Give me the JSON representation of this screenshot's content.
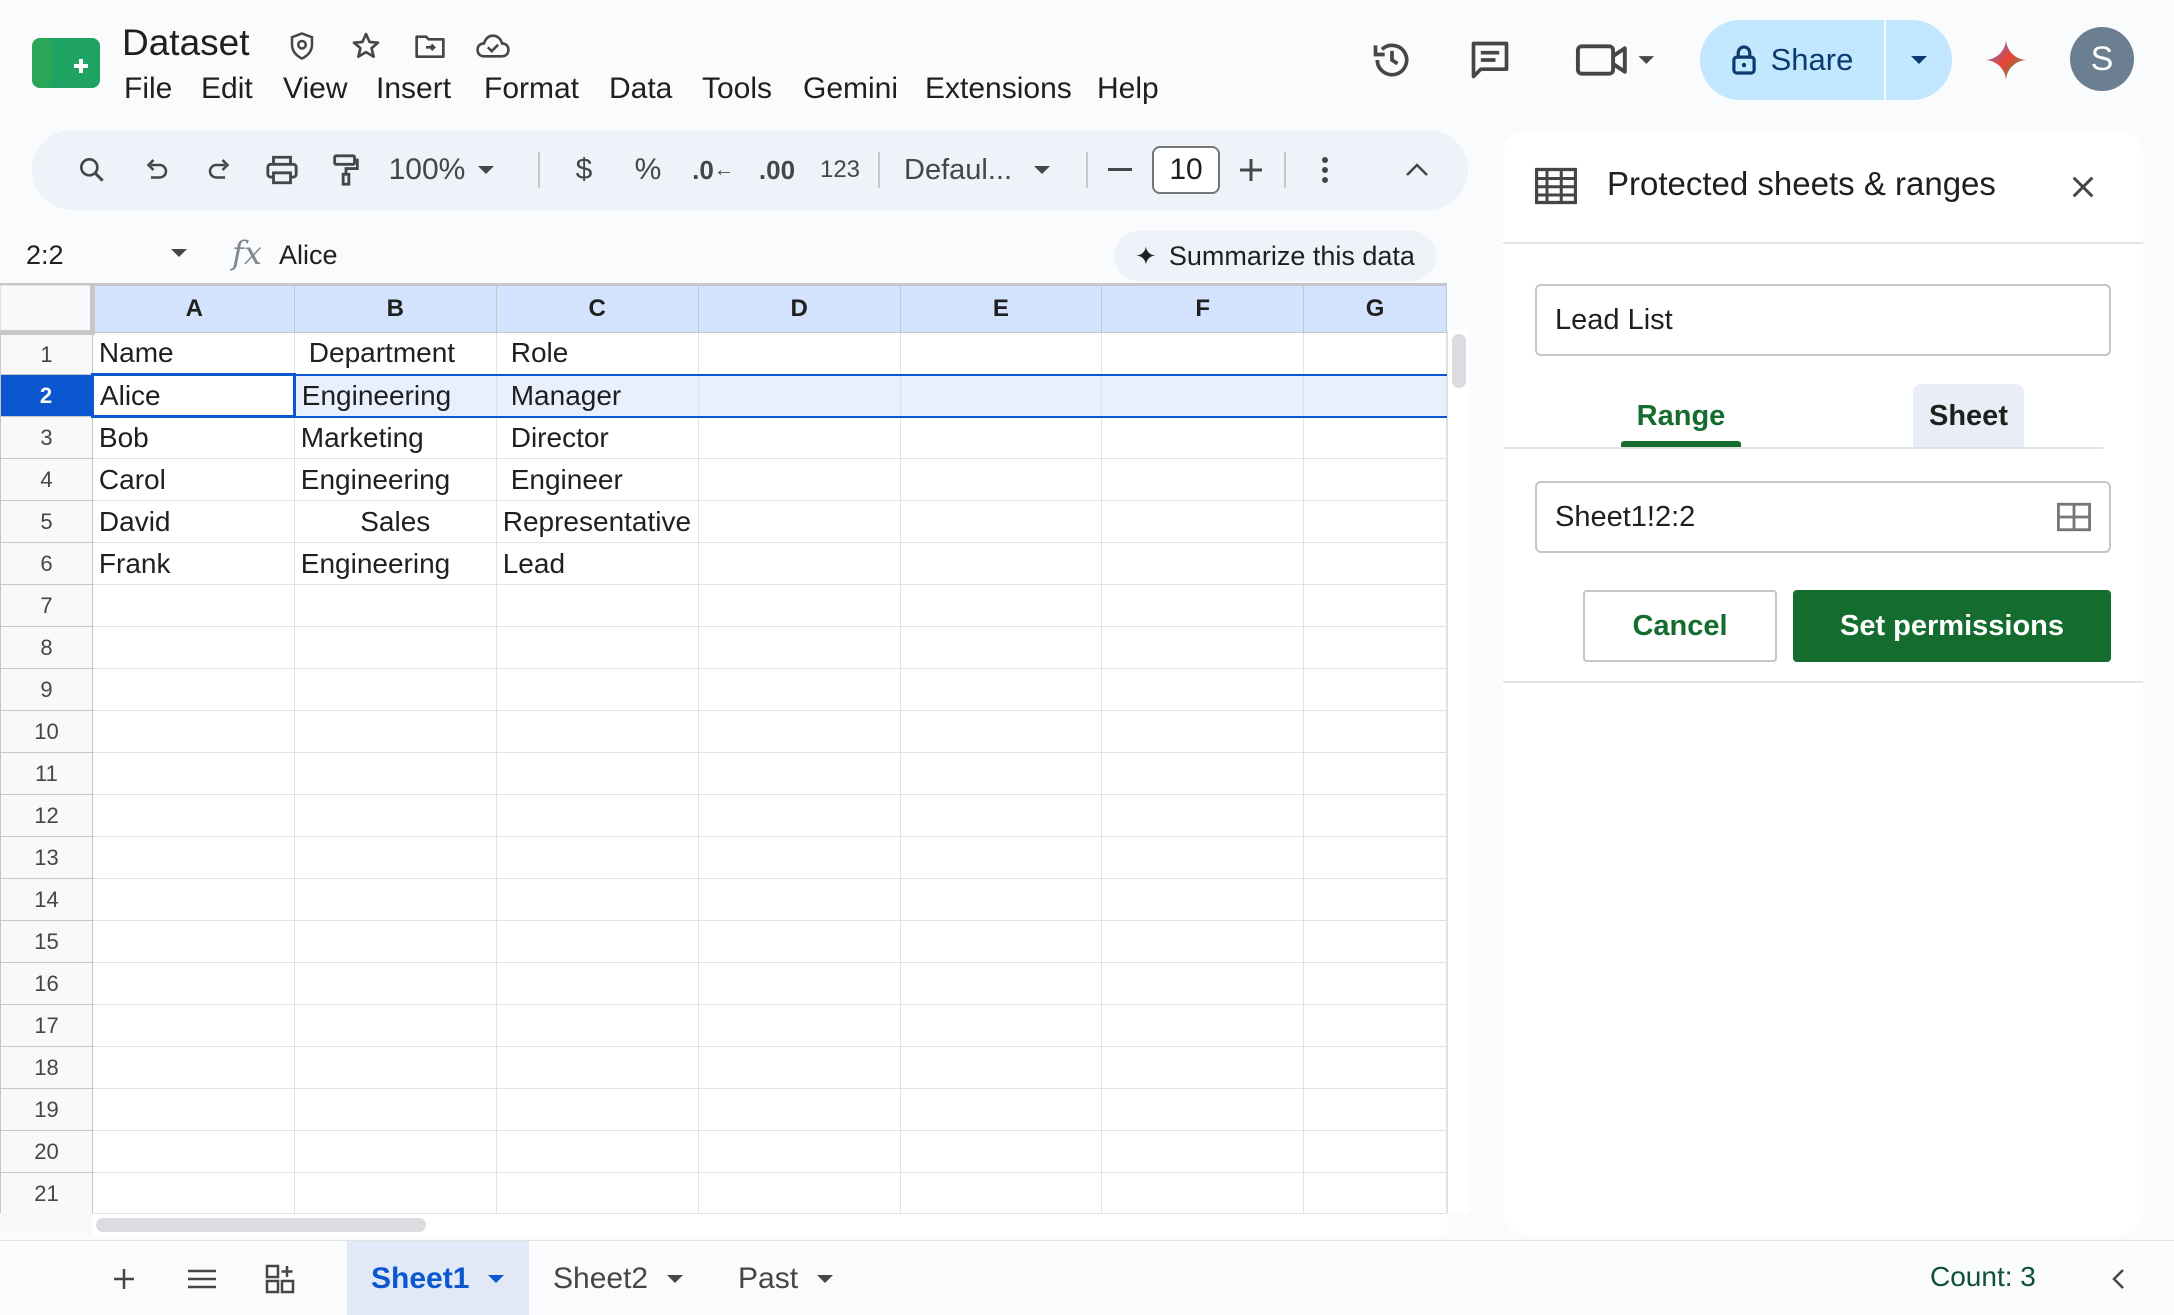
{
  "app": {
    "title": "Dataset",
    "menu": [
      "File",
      "Edit",
      "View",
      "Insert",
      "Format",
      "Data",
      "Tools",
      "Gemini",
      "Extensions",
      "Help"
    ],
    "share_label": "Share",
    "avatar_letter": "S"
  },
  "toolbar": {
    "zoom": "100%",
    "currency": "$",
    "percent": "%",
    "decrease_decimal": ".0",
    "increase_decimal": ".00",
    "number_format": "123",
    "font": "Defaul...",
    "font_size": "10"
  },
  "formula_bar": {
    "name_box": "2:2",
    "fx": "fx",
    "value": "Alice",
    "summarize_label": "Summarize this data"
  },
  "grid": {
    "columns": [
      "A",
      "B",
      "C",
      "D",
      "E",
      "F",
      "G"
    ],
    "row_count": 21,
    "selected_row": 2,
    "cells": [
      [
        "Name",
        "Department",
        "Role"
      ],
      [
        "Alice",
        "Engineering",
        "Manager"
      ],
      [
        "Bob",
        "Marketing",
        "Director"
      ],
      [
        "Carol",
        "Engineering",
        "Engineer"
      ],
      [
        "David",
        "Sales",
        "Representative"
      ],
      [
        "Frank",
        "Engineering",
        "Lead"
      ]
    ]
  },
  "sheets": {
    "tabs": [
      "Sheet1",
      "Sheet2",
      "Past"
    ],
    "active": "Sheet1",
    "count_label": "Count: 3"
  },
  "panel": {
    "title": "Protected sheets & ranges",
    "description_value": "Lead List",
    "tab_range": "Range",
    "tab_sheet": "Sheet",
    "range_value": "Sheet1!2:2",
    "cancel_label": "Cancel",
    "set_permissions_label": "Set permissions"
  },
  "colors": {
    "accent_green": "#146c2e",
    "selection_blue": "#0b57d0",
    "share_bg": "#c2e7ff"
  }
}
